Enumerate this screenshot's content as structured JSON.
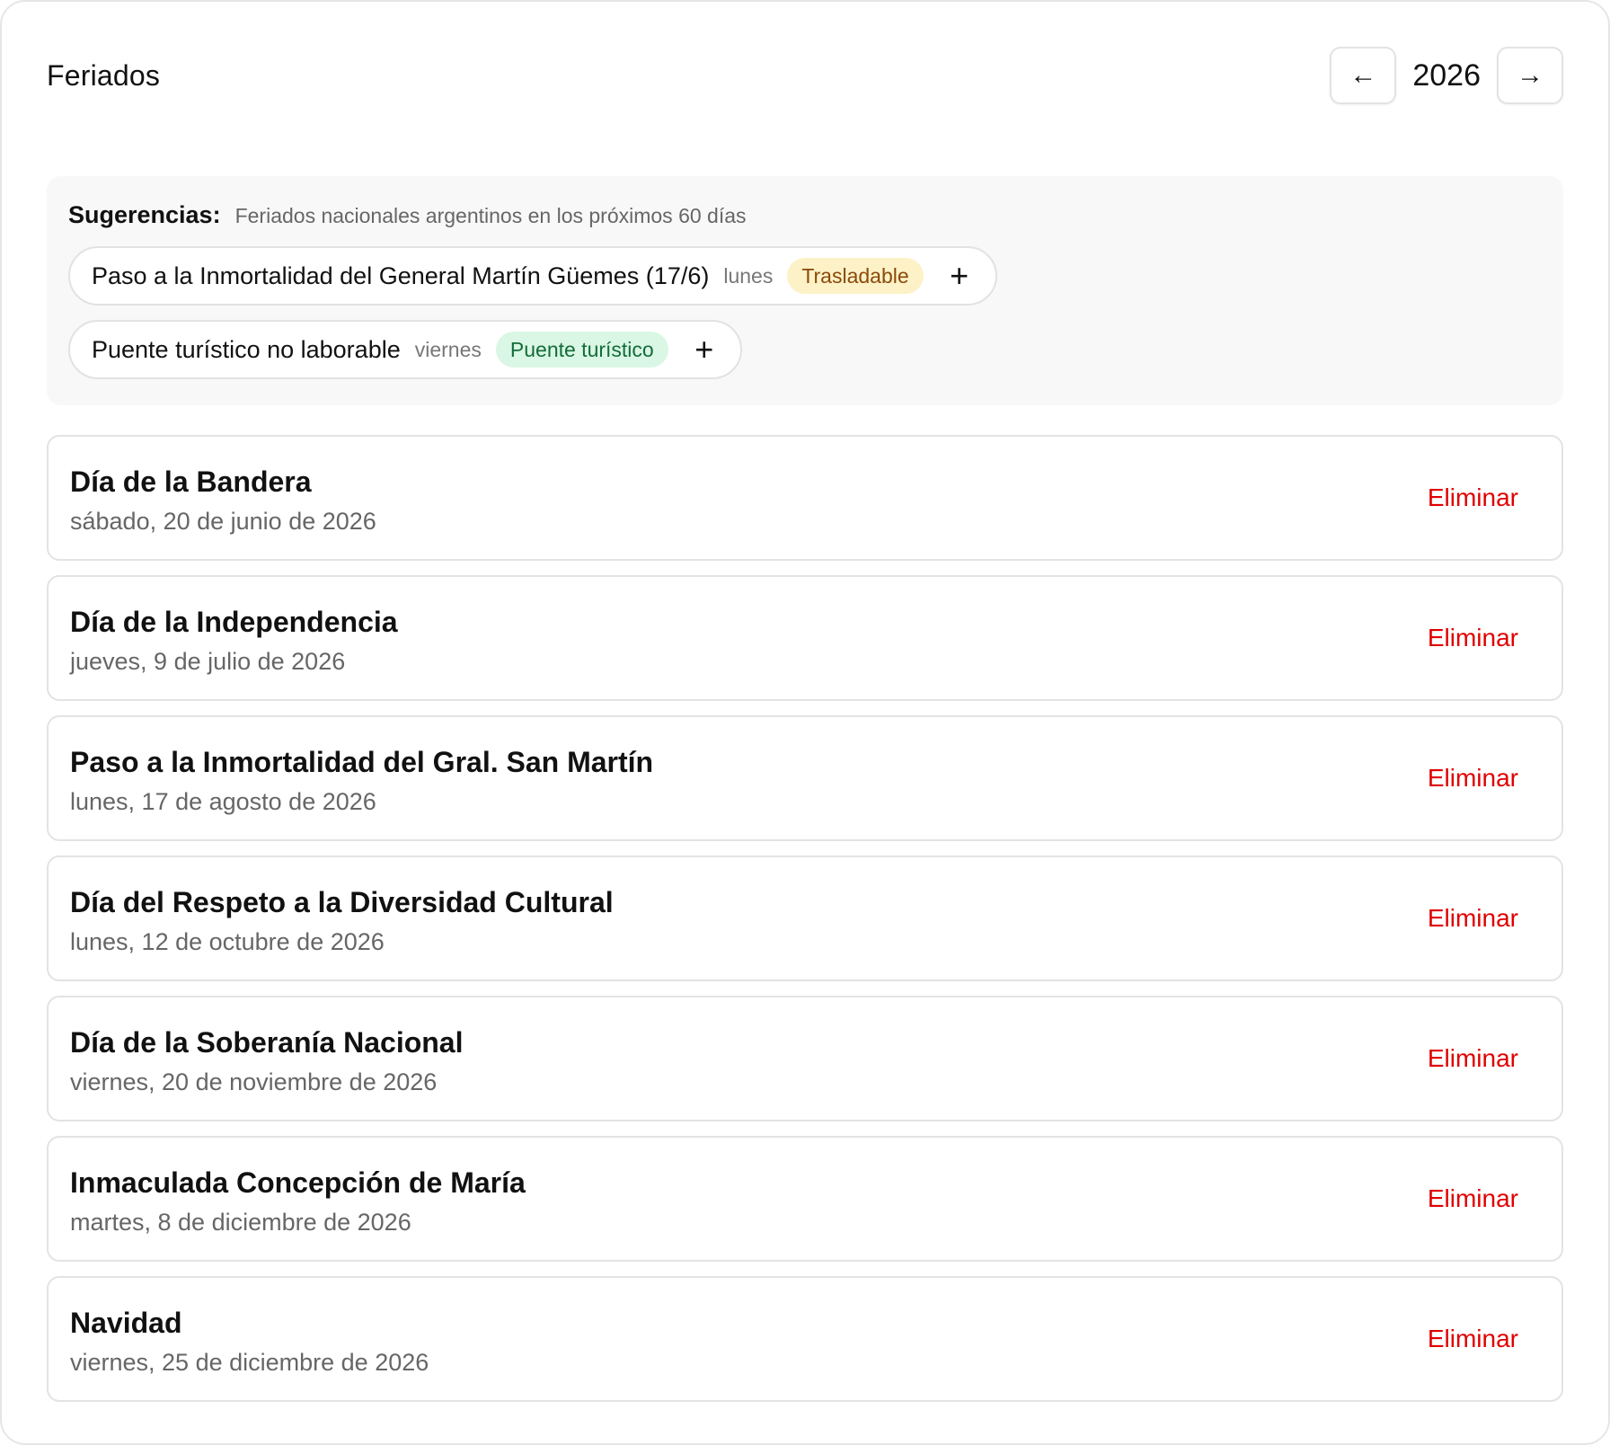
{
  "header": {
    "title": "Feriados",
    "prev_label": "←",
    "year": "2026",
    "next_label": "→"
  },
  "suggestions": {
    "title": "Sugerencias:",
    "subtitle": "Feriados nacionales argentinos en los próximos 60 días",
    "items": [
      {
        "name": "Paso a la Inmortalidad del General Martín Güemes (17/6)",
        "day": "lunes",
        "badge": "Trasladable",
        "badge_color": "#fdf1c7",
        "add_icon": "plus-icon"
      },
      {
        "name": "Puente turístico no laborable",
        "day": "viernes",
        "badge": "Puente turístico",
        "badge_color": "#d9f7e4",
        "add_icon": "plus-icon"
      }
    ]
  },
  "holidays": [
    {
      "name": "Día de la Bandera",
      "date": "sábado, 20 de junio de 2026",
      "action": "Eliminar"
    },
    {
      "name": "Día de la Independencia",
      "date": "jueves, 9 de julio de 2026",
      "action": "Eliminar"
    },
    {
      "name": "Paso a la Inmortalidad del Gral. San Martín",
      "date": "lunes, 17 de agosto de 2026",
      "action": "Eliminar"
    },
    {
      "name": "Día del Respeto a la Diversidad Cultural",
      "date": "lunes, 12 de octubre de 2026",
      "action": "Eliminar"
    },
    {
      "name": "Día de la Soberanía Nacional",
      "date": "viernes, 20 de noviembre de 2026",
      "action": "Eliminar"
    },
    {
      "name": "Inmaculada Concepción de María",
      "date": "martes, 8 de diciembre de 2026",
      "action": "Eliminar"
    },
    {
      "name": "Navidad",
      "date": "viernes, 25 de diciembre de 2026",
      "action": "Eliminar"
    }
  ],
  "colors": {
    "delete": "#e00000",
    "border": "#e3e3e3",
    "suggestions_bg": "#f8f8f8"
  }
}
